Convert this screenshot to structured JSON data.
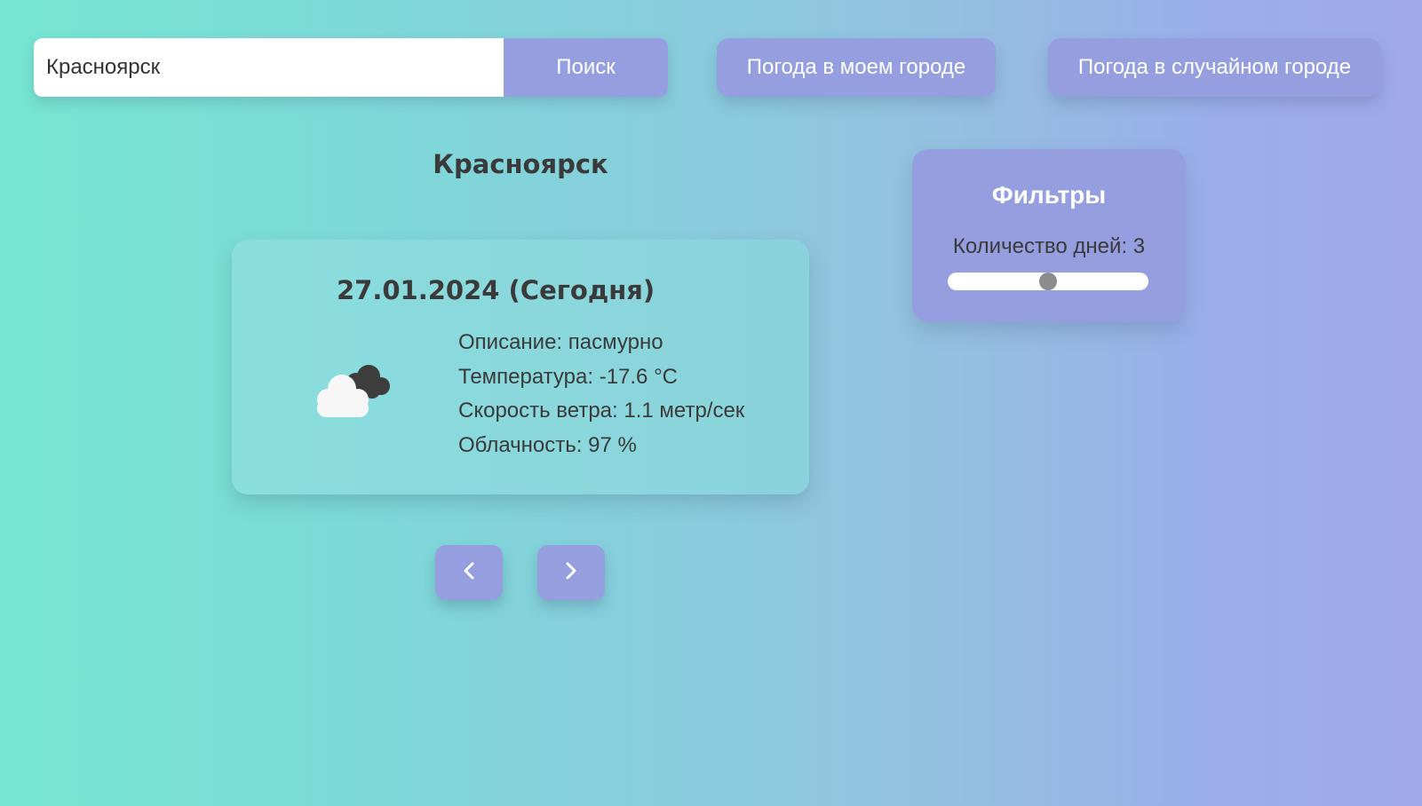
{
  "search": {
    "value": "Красноярск",
    "button_label": "Поиск"
  },
  "buttons": {
    "my_city": "Погода в моем городе",
    "random_city": "Погода в случайном городе"
  },
  "city": {
    "name": "Красноярск"
  },
  "forecast": {
    "date": "27.01.2024 (Сегодня)",
    "icon": "cloudy-icon",
    "description": "Описание: пасмурно",
    "temperature": "Температура: -17.6 °C",
    "wind": "Скорость ветра: 1.1 метр/сек",
    "clouds": "Облачность: 97 %"
  },
  "nav": {
    "prev_icon": "chevron-left-icon",
    "next_icon": "chevron-right-icon"
  },
  "filters": {
    "title": "Фильтры",
    "days_label": "Количество дней: 3",
    "days_slider_fraction": 0.5
  },
  "colors": {
    "accent": "#959fe0",
    "gradient_start": "#76e6d3",
    "gradient_end": "#a0a9ea",
    "text": "#3a3a3a"
  }
}
